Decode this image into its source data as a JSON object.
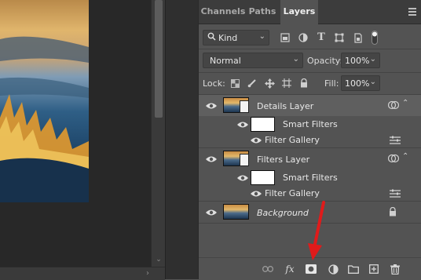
{
  "panel": {
    "tabs": [
      {
        "label": "Channels",
        "active": false
      },
      {
        "label": "Paths",
        "active": false
      },
      {
        "label": "Layers",
        "active": true
      }
    ],
    "filter": {
      "kind_label": "Kind"
    },
    "blend": {
      "mode": "Normal",
      "opacity_label": "Opacity:",
      "opacity_value": "100%"
    },
    "lock": {
      "label": "Lock:",
      "fill_label": "Fill:",
      "fill_value": "100%"
    },
    "layers": [
      {
        "name": "Details Layer",
        "selected": true,
        "smart_filters_label": "Smart Filters",
        "filter_name": "Filter Gallery"
      },
      {
        "name": "Filters Layer",
        "selected": false,
        "smart_filters_label": "Smart Filters",
        "filter_name": "Filter Gallery"
      },
      {
        "name": "Background",
        "selected": false,
        "locked": true
      }
    ]
  },
  "colors": {
    "panel_bg": "#535353",
    "selected_row": "#5f5f5f",
    "arrow": "#e01b1b"
  },
  "icons": {
    "filter_types": [
      "pixel-layer-icon",
      "adjustment-icon",
      "type-icon",
      "shape-icon",
      "smart-object-icon",
      "toggle-icon"
    ],
    "lock_types": [
      "lock-transparent-icon",
      "lock-paint-icon",
      "lock-move-icon",
      "lock-artboard-icon",
      "lock-all-icon"
    ],
    "bottom_bar": [
      "link-icon",
      "fx-icon",
      "add-mask-icon",
      "adjustment-layer-icon",
      "new-group-icon",
      "new-layer-icon",
      "trash-icon"
    ]
  }
}
